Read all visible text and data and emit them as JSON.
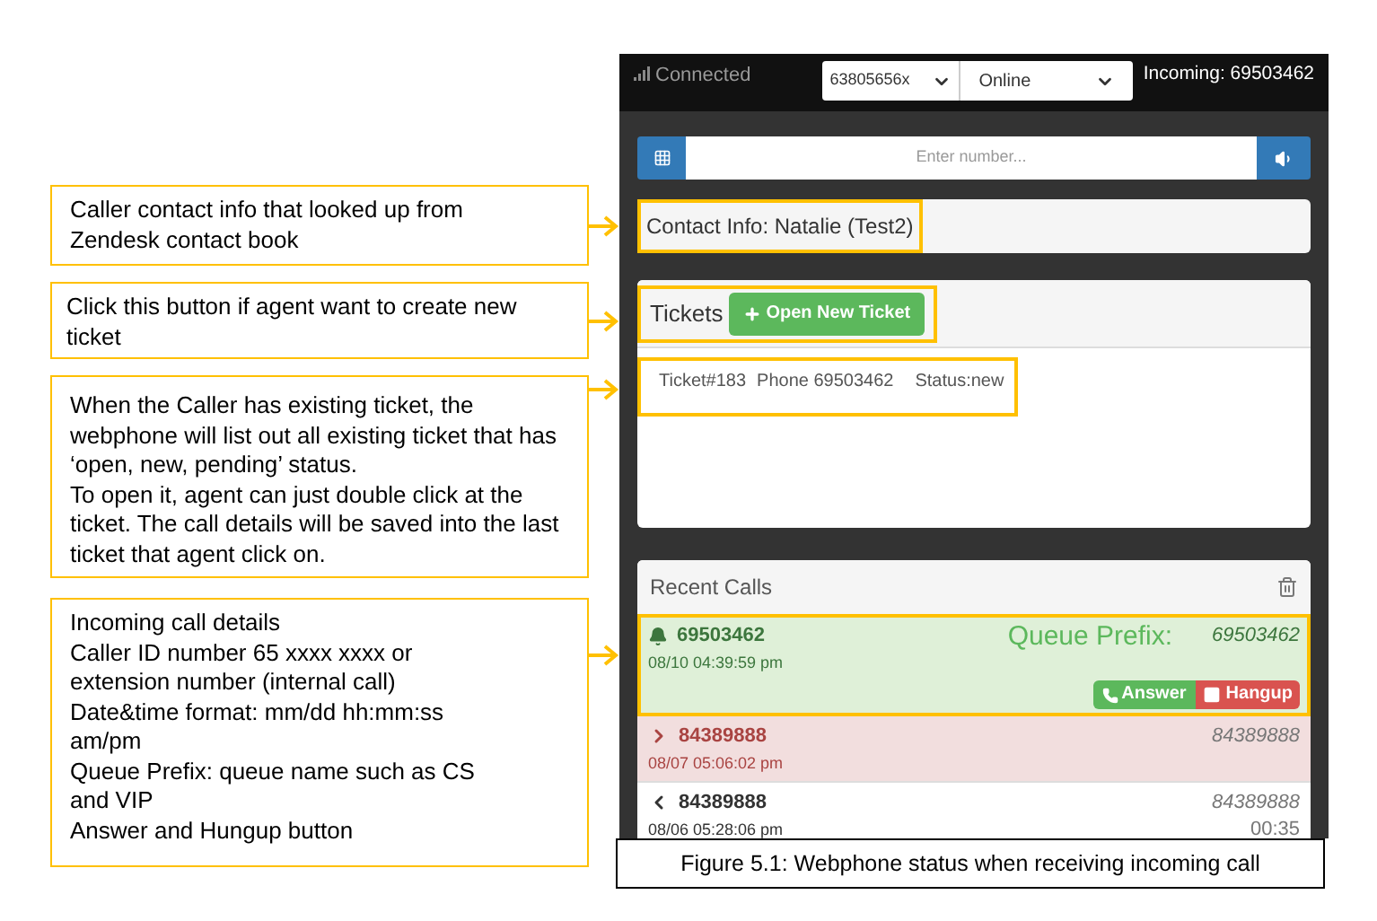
{
  "callouts": [
    {
      "lines": [
        "Caller contact info that looked up from Zendesk contact book"
      ]
    },
    {
      "lines": [
        "Click this button if agent want to create new ticket"
      ]
    },
    {
      "lines": [
        "When the Caller has existing ticket, the webphone will list out all existing ticket that has ‘open, new, pending’ status.",
        "To open it, agent can just double click at the ticket. The call details will be saved into the last ticket that agent click on."
      ]
    },
    {
      "lines": [
        "Incoming call details",
        "Caller ID number 65 xxxx xxxx or extension number (internal call)",
        "Date&time  format: mm/dd  hh:mm:ss am/pm",
        "Queue Prefix: queue name such as CS and VIP",
        "Answer and Hungup button"
      ]
    }
  ],
  "phone": {
    "status": "Connected",
    "extension": "63805656x",
    "presence": "Online",
    "incoming": "Incoming: 69503462",
    "number_field": {
      "placeholder": "Enter number..."
    },
    "contact_info": "Contact Info: Natalie (Test2)",
    "tickets": {
      "title": "Tickets",
      "new_button": "Open New Ticket",
      "items": [
        {
          "id": "Ticket#183",
          "phone": "Phone 69503462",
          "status": "Status:new"
        }
      ]
    },
    "recent_calls": {
      "title": "Recent Calls",
      "calls": [
        {
          "kind": "incoming",
          "number": "69503462",
          "time": "08/10 04:39:59 pm",
          "queue_label": "Queue Prefix:",
          "line": "69503462",
          "answer": "Answer",
          "hangup": "Hangup"
        },
        {
          "kind": "missed",
          "number": "84389888",
          "time": "08/07 05:06:02 pm",
          "line": "84389888"
        },
        {
          "kind": "outgoing",
          "number": "84389888",
          "time": "08/06 05:28:06 pm",
          "line": "84389888",
          "duration": "00:35"
        }
      ]
    }
  },
  "caption": "Figure 5.1: Webphone status when receiving incoming call"
}
